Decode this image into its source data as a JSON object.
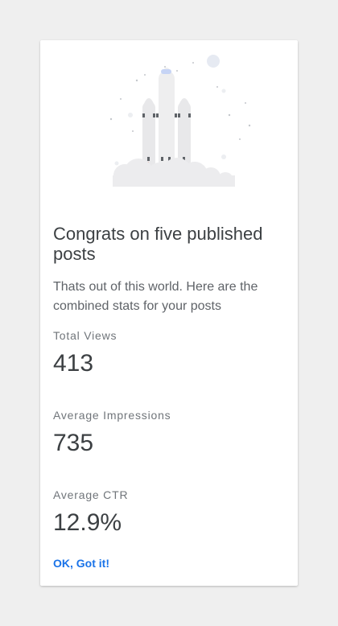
{
  "card": {
    "title": "Congrats on five published posts",
    "description": "Thats out of this world. Here are the combined stats for your posts",
    "stats": [
      {
        "label": "Total Views",
        "value": "413"
      },
      {
        "label": "Average Impressions",
        "value": "735"
      },
      {
        "label": "Average CTR",
        "value": "12.9%"
      }
    ],
    "action_label": "OK, Got it!"
  },
  "colors": {
    "page_background": "#efefef",
    "card_background": "#ffffff",
    "title_text": "#3c4043",
    "body_text": "#5f6368",
    "accent": "#1a73e8",
    "flame": "#f4511e"
  },
  "icons": {
    "hero": "rocket-launch-illustration"
  }
}
